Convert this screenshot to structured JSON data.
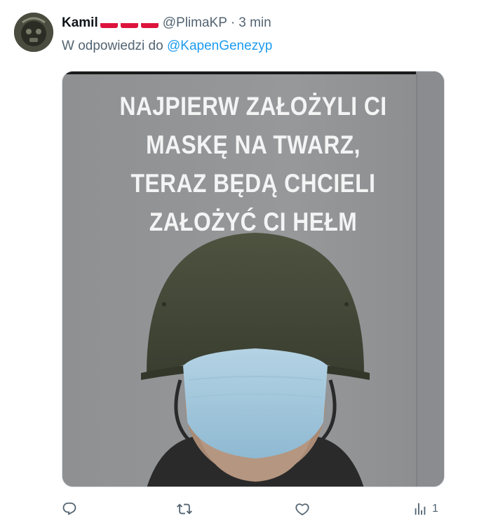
{
  "tweet": {
    "author_name": "Kamil",
    "flags": [
      "poland-flag",
      "poland-flag",
      "poland-flag"
    ],
    "handle": "@PlimaKP",
    "separator": "·",
    "time": "3 min",
    "reply_prefix": "W odpowiedzi do",
    "reply_mention": "@KapenGenezyp"
  },
  "media": {
    "text_lines": [
      "NAJPIERW ZAŁOŻYLI CI",
      "MASKĘ NA TWARZ,",
      "TERAZ BĘDĄ CHCIELI",
      "ZAŁOŻYĆ CI HEŁM"
    ]
  },
  "actions": {
    "reply_icon": "reply-icon",
    "retweet_icon": "retweet-icon",
    "like_icon": "heart-icon",
    "views_icon": "views-icon",
    "views_count": "1"
  },
  "colors": {
    "accent": "#1d9bf0",
    "muted": "#536471",
    "flag_red": "#dc143c"
  }
}
